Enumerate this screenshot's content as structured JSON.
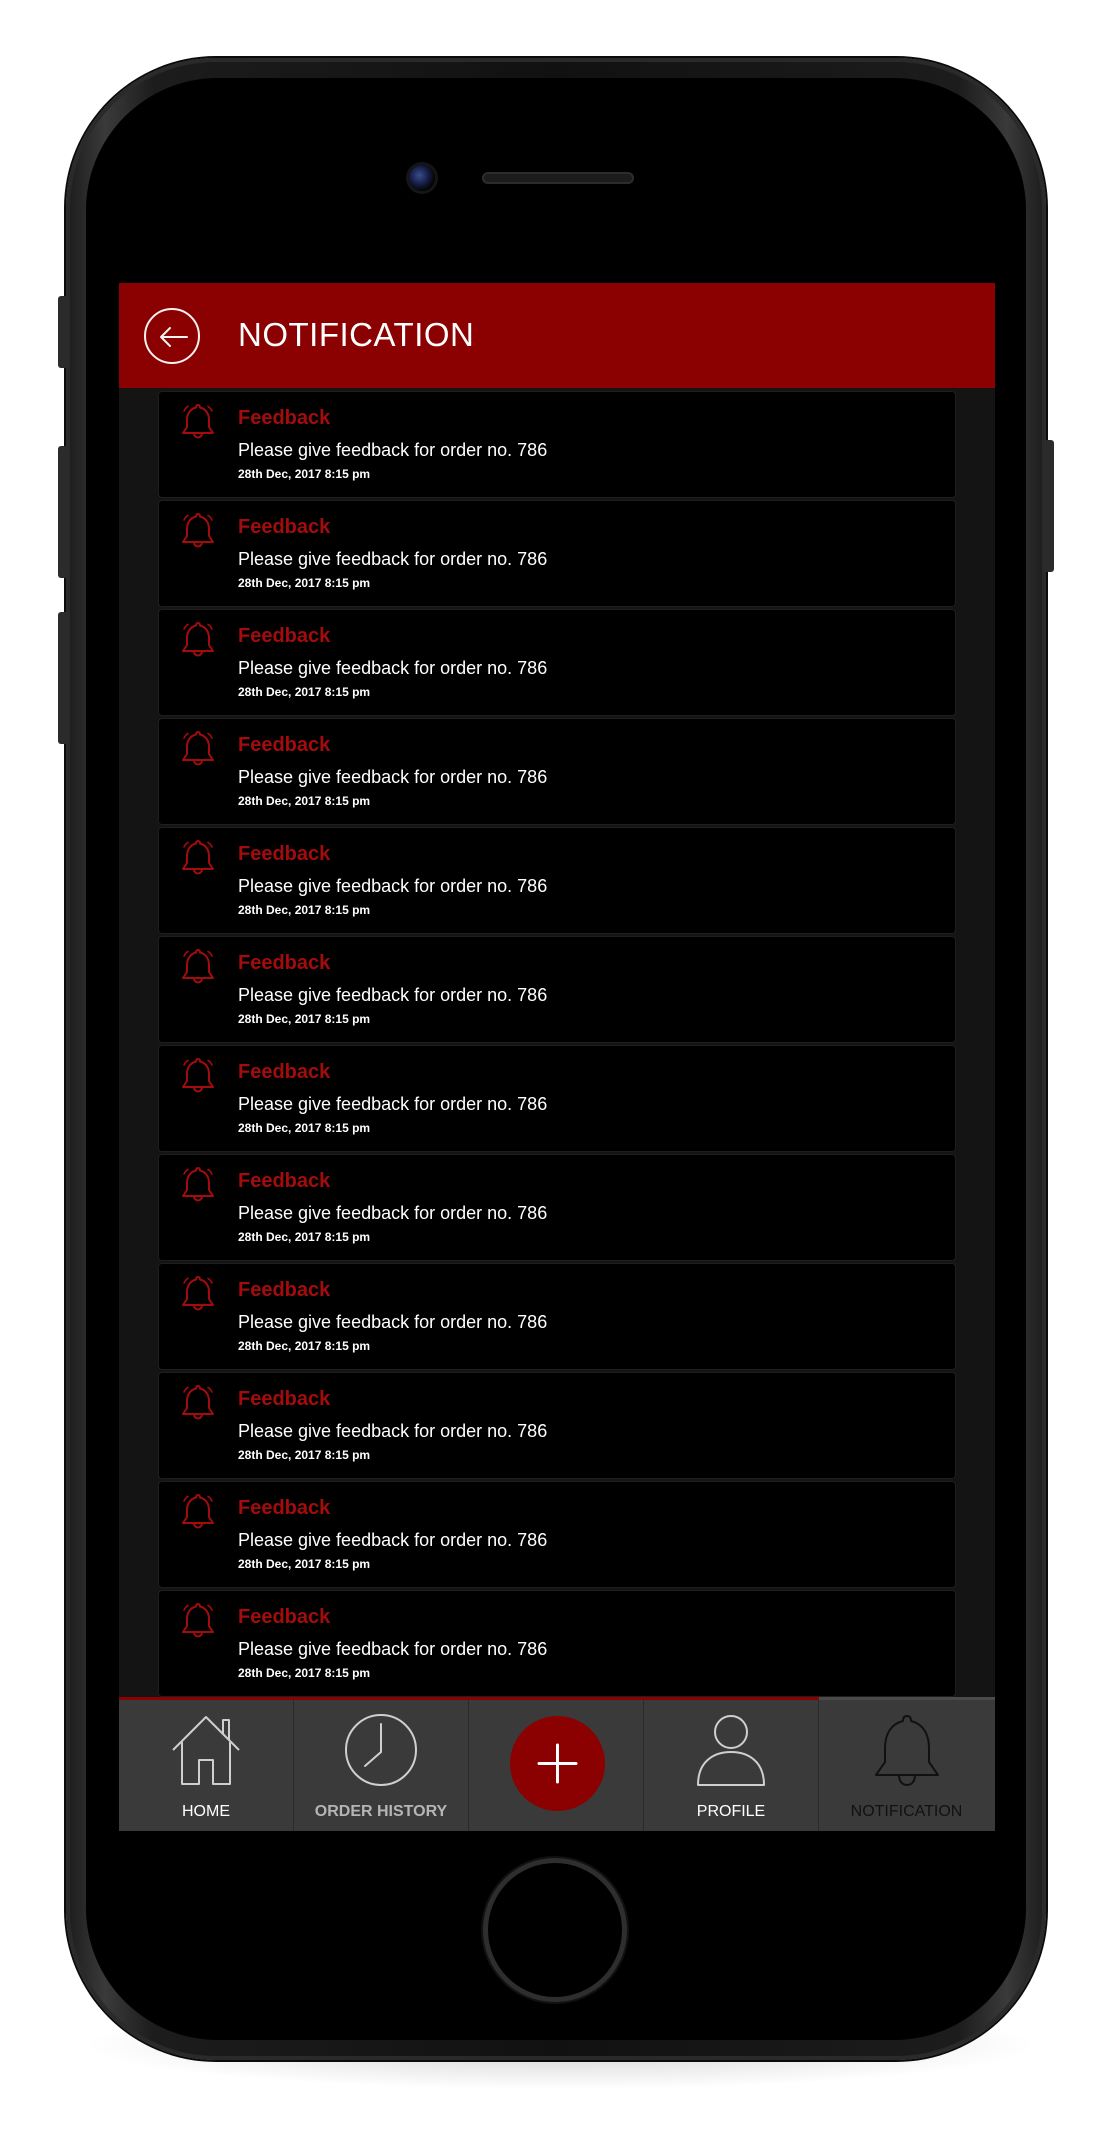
{
  "header": {
    "title": "NOTIFICATION"
  },
  "notifications": [
    {
      "title": "Feedback",
      "message": "Please give feedback for order no. 786",
      "date": "28th Dec, 2017 8:15 pm"
    },
    {
      "title": "Feedback",
      "message": "Please give feedback for order no. 786",
      "date": "28th Dec, 2017 8:15 pm"
    },
    {
      "title": "Feedback",
      "message": "Please give feedback for order no. 786",
      "date": "28th Dec, 2017 8:15 pm"
    },
    {
      "title": "Feedback",
      "message": "Please give feedback for order no. 786",
      "date": "28th Dec, 2017 8:15 pm"
    },
    {
      "title": "Feedback",
      "message": "Please give feedback for order no. 786",
      "date": "28th Dec, 2017 8:15 pm"
    },
    {
      "title": "Feedback",
      "message": "Please give feedback for order no. 786",
      "date": "28th Dec, 2017 8:15 pm"
    },
    {
      "title": "Feedback",
      "message": "Please give feedback for order no. 786",
      "date": "28th Dec, 2017 8:15 pm"
    },
    {
      "title": "Feedback",
      "message": "Please give feedback for order no. 786",
      "date": "28th Dec, 2017 8:15 pm"
    },
    {
      "title": "Feedback",
      "message": "Please give feedback for order no. 786",
      "date": "28th Dec, 2017 8:15 pm"
    },
    {
      "title": "Feedback",
      "message": "Please give feedback for order no. 786",
      "date": "28th Dec, 2017 8:15 pm"
    },
    {
      "title": "Feedback",
      "message": "Please give feedback for order no. 786",
      "date": "28th Dec, 2017 8:15 pm"
    },
    {
      "title": "Feedback",
      "message": "Please give feedback for order no. 786",
      "date": "28th Dec, 2017 8:15 pm"
    }
  ],
  "tabbar": {
    "home": "HOME",
    "order_history": "ORDER HISTORY",
    "profile": "PROFILE",
    "notification": "NOTIFICATION"
  },
  "icons": {
    "back": "arrow-left-icon",
    "bell": "bell-icon",
    "home": "house-icon",
    "order_history": "clock-icon",
    "add": "plus-icon",
    "profile": "person-icon",
    "notification": "bell-icon"
  },
  "colors": {
    "accent": "#8b0000",
    "notification_title": "#a30c0c",
    "tab_active_text": "#ffffff",
    "tab_inactive_text": "#b5b5b5",
    "tab_current_text": "#111111"
  }
}
